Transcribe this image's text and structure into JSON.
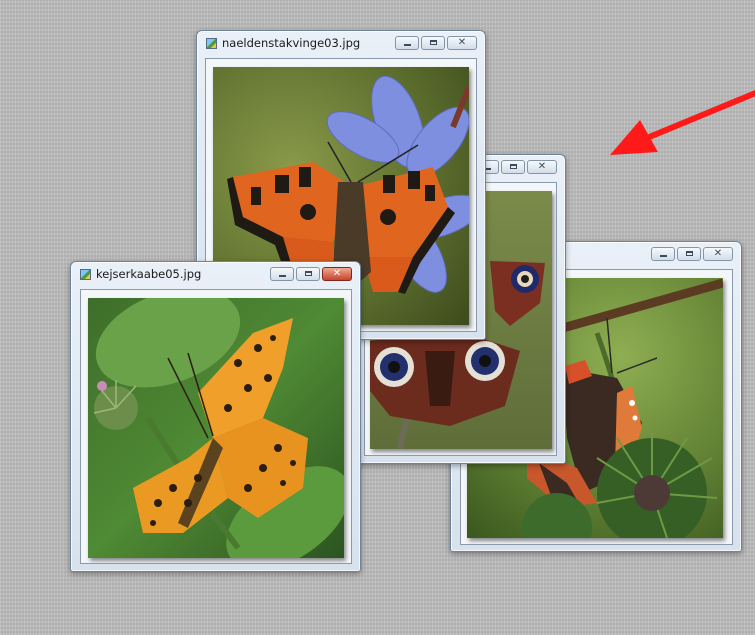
{
  "windows": {
    "win1": {
      "title": "naeldenstakvinge03.jpg",
      "subject": "small tortoiseshell butterfly on blue chicory flower"
    },
    "win2": {
      "title": "",
      "subject": "peacock butterfly on branch"
    },
    "win3": {
      "title": "",
      "subject": "red admiral butterfly on burdock"
    },
    "win4": {
      "title": "kejserkaabe05.jpg",
      "subject": "silver-washed fritillary butterfly on green leaves"
    }
  },
  "controls": {
    "minimize": "minimize-button",
    "maximize": "maximize-button",
    "close": "close-button"
  },
  "icons": {
    "app": "image-file-icon",
    "arrow": "red-arrow-annotation"
  },
  "colors": {
    "arrow": "#ff0000",
    "desktop": "#bcbcbc",
    "close_active": "#c8452c"
  }
}
